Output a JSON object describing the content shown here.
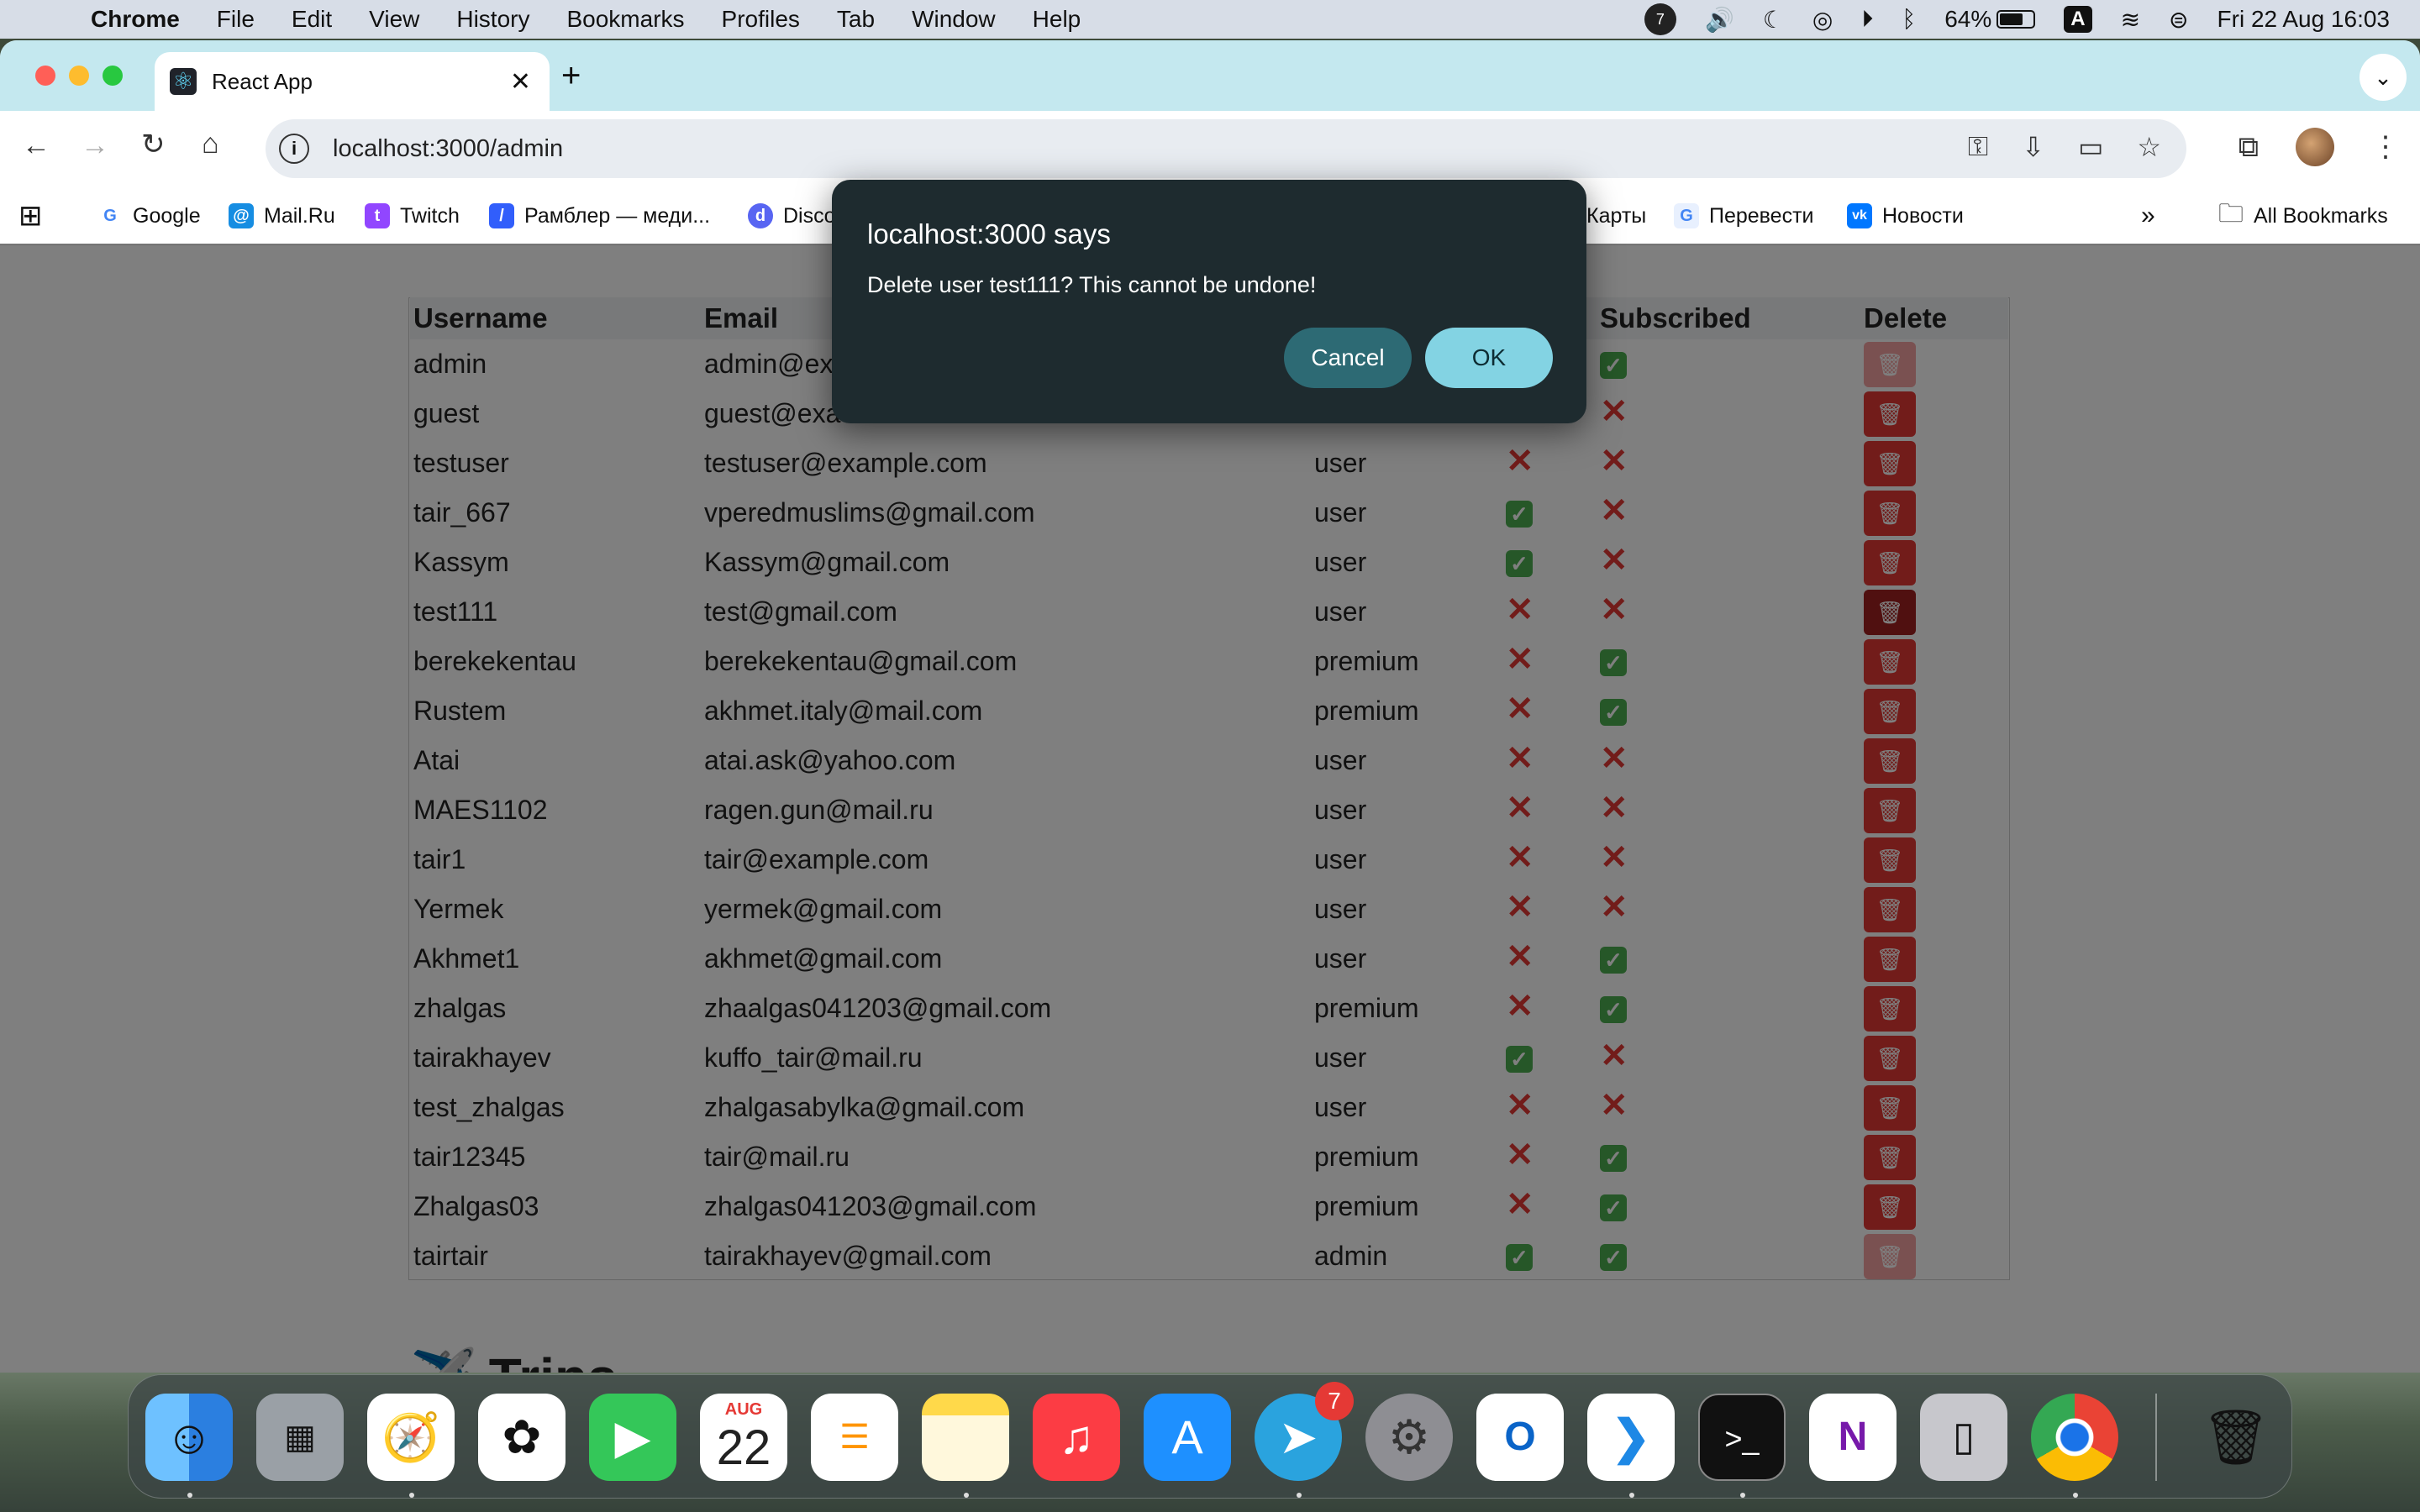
{
  "menubar": {
    "app": "Chrome",
    "items": [
      "File",
      "Edit",
      "View",
      "History",
      "Bookmarks",
      "Profiles",
      "Tab",
      "Window",
      "Help"
    ],
    "battery": "64%",
    "input_source": "A",
    "datetime": "Fri 22 Aug  16:03",
    "badge_count": "7"
  },
  "browser": {
    "tab_title": "React App",
    "url": "localhost:3000/admin"
  },
  "bookmarks": [
    {
      "label": "Google",
      "icon": "G",
      "color": "#4285f4"
    },
    {
      "label": "Mail.Ru",
      "icon": "@",
      "color": "#168de2"
    },
    {
      "label": "Twitch",
      "icon": "t",
      "color": "#9146ff"
    },
    {
      "label": "Рамблер — меди...",
      "icon": "/",
      "color": "#315efb"
    },
    {
      "label": "Disco",
      "icon": "d",
      "color": "#5865f2"
    },
    {
      "label": "Карты",
      "icon": "",
      "color": "#ffffff"
    },
    {
      "label": "Перевести",
      "icon": "G",
      "color": "#4285f4"
    },
    {
      "label": "Новости",
      "icon": "vk",
      "color": "#0077ff"
    }
  ],
  "all_bookmarks": "All Bookmarks",
  "table": {
    "headers": {
      "username": "Username",
      "email": "Email",
      "subscribed": "Subscribed",
      "delete": "Delete"
    },
    "rows": [
      {
        "username": "admin",
        "email": "admin@ex",
        "role": "",
        "a": "",
        "b": true
      },
      {
        "username": "guest",
        "email": "guest@exa",
        "role": "",
        "a": "",
        "b": false
      },
      {
        "username": "testuser",
        "email": "testuser@example.com",
        "role": "user",
        "a": false,
        "b": false
      },
      {
        "username": "tair_667",
        "email": "vperedmuslims@gmail.com",
        "role": "user",
        "a": true,
        "b": false
      },
      {
        "username": "Kassym",
        "email": "Kassym@gmail.com",
        "role": "user",
        "a": true,
        "b": false
      },
      {
        "username": "test111",
        "email": "test@gmail.com",
        "role": "user",
        "a": false,
        "b": false
      },
      {
        "username": "berekekentau",
        "email": "berekekentau@gmail.com",
        "role": "premium",
        "a": false,
        "b": true
      },
      {
        "username": "Rustem",
        "email": "akhmet.italy@mail.com",
        "role": "premium",
        "a": false,
        "b": true
      },
      {
        "username": "Atai",
        "email": "atai.ask@yahoo.com",
        "role": "user",
        "a": false,
        "b": false
      },
      {
        "username": "MAES1102",
        "email": "ragen.gun@mail.ru",
        "role": "user",
        "a": false,
        "b": false
      },
      {
        "username": "tair1",
        "email": "tair@example.com",
        "role": "user",
        "a": false,
        "b": false
      },
      {
        "username": "Yermek",
        "email": "yermek@gmail.com",
        "role": "user",
        "a": false,
        "b": false
      },
      {
        "username": "Akhmet1",
        "email": "akhmet@gmail.com",
        "role": "user",
        "a": false,
        "b": true
      },
      {
        "username": "zhalgas",
        "email": "zhaalgas041203@gmail.com",
        "role": "premium",
        "a": false,
        "b": true
      },
      {
        "username": "tairakhayev",
        "email": "kuffo_tair@mail.ru",
        "role": "user",
        "a": true,
        "b": false
      },
      {
        "username": "test_zhalgas",
        "email": "zhalgasabylka@gmail.com",
        "role": "user",
        "a": false,
        "b": false
      },
      {
        "username": "tair12345",
        "email": "tair@mail.ru",
        "role": "premium",
        "a": false,
        "b": true
      },
      {
        "username": "Zhalgas03",
        "email": "zhalgas041203@gmail.com",
        "role": "premium",
        "a": false,
        "b": true
      },
      {
        "username": "tairtair",
        "email": "tairakhayev@gmail.com",
        "role": "admin",
        "a": true,
        "b": true
      }
    ]
  },
  "trips_heading": "Trips",
  "dialog": {
    "title": "localhost:3000 says",
    "message": "Delete user test111? This cannot be undone!",
    "cancel": "Cancel",
    "ok": "OK"
  },
  "dock": {
    "apps": [
      "finder",
      "launchpad",
      "safari",
      "photos",
      "facetime",
      "calendar",
      "reminders",
      "notes",
      "music",
      "app-store",
      "telegram",
      "system-settings",
      "outlook",
      "vscode",
      "terminal",
      "onenote",
      "iphone-mirroring",
      "chrome",
      "trash"
    ],
    "calendar_month": "AUG",
    "calendar_day": "22",
    "telegram_badge": "7"
  }
}
